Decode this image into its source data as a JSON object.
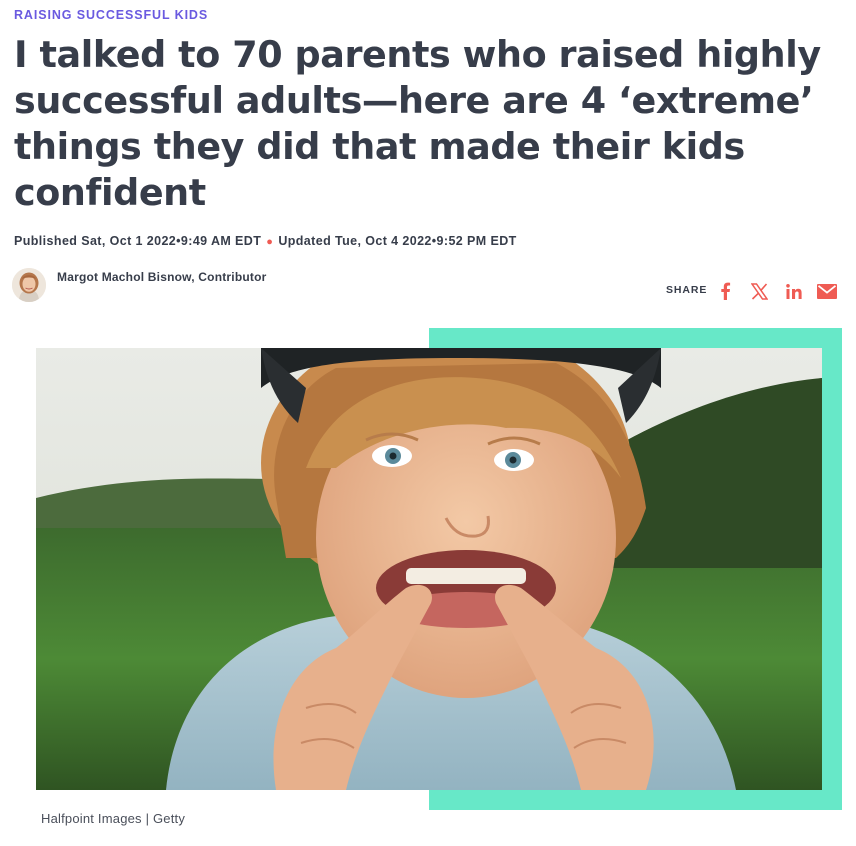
{
  "article": {
    "kicker": "RAISING SUCCESSFUL KIDS",
    "headline": "I talked to 70 parents who raised highly successful adults—here are 4 ‘extreme’ things they did that made their kids confident",
    "published": "Published Sat, Oct 1 2022•9:49 AM EDT",
    "updated": "Updated Tue, Oct 4 2022•9:52 PM EDT",
    "author": "Margot Machol Bisnow, Contributor"
  },
  "share": {
    "label": "SHARE",
    "icons": [
      "facebook-icon",
      "x-icon",
      "linkedin-icon",
      "email-icon"
    ],
    "icon_color": "#ef5b53"
  },
  "image": {
    "caption": "Halfpoint Images | Getty",
    "accent_color": "#67e8c8"
  },
  "colors": {
    "kicker": "#6a5ae0",
    "text": "#373d4a",
    "separator_dot": "#ef5b53"
  }
}
